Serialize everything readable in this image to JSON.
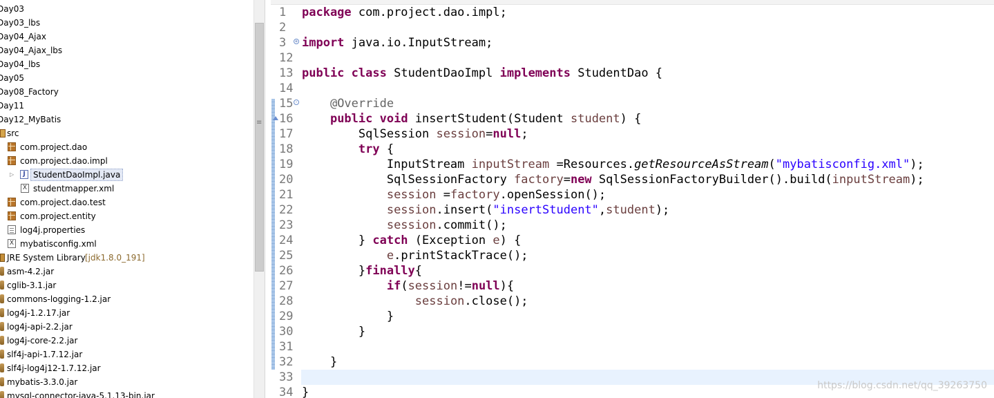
{
  "explorer": {
    "rows": [
      {
        "label": "Day03",
        "icon": "project-icon"
      },
      {
        "label": "Day03_lbs",
        "icon": "project-icon"
      },
      {
        "label": "Day04_Ajax",
        "icon": "project-icon"
      },
      {
        "label": "Day04_Ajax_lbs",
        "icon": "project-icon"
      },
      {
        "label": "Day04_lbs",
        "icon": "project-icon"
      },
      {
        "label": "Day05",
        "icon": "project-icon"
      },
      {
        "label": "Day08_Factory",
        "icon": "project-icon"
      },
      {
        "label": "Day11",
        "icon": "project-icon"
      },
      {
        "label": "Day12_MyBatis",
        "icon": "project-icon"
      },
      {
        "label": "src",
        "icon": "source-folder-icon"
      },
      {
        "label": "com.project.dao",
        "icon": "package-icon"
      },
      {
        "label": "com.project.dao.impl",
        "icon": "package-icon"
      },
      {
        "label": "StudentDaoImpl.java",
        "icon": "java-file-icon",
        "selected": true
      },
      {
        "label": "studentmapper.xml",
        "icon": "xml-file-icon"
      },
      {
        "label": "com.project.dao.test",
        "icon": "package-icon"
      },
      {
        "label": "com.project.entity",
        "icon": "package-icon"
      },
      {
        "label": "log4j.properties",
        "icon": "properties-file-icon"
      },
      {
        "label": "mybatisconfig.xml",
        "icon": "xml-file-icon"
      },
      {
        "label": "JRE System Library",
        "suffix": "[jdk1.8.0_191]",
        "icon": "library-icon"
      },
      {
        "label": "asm-4.2.jar",
        "icon": "jar-icon"
      },
      {
        "label": "cglib-3.1.jar",
        "icon": "jar-icon"
      },
      {
        "label": "commons-logging-1.2.jar",
        "icon": "jar-icon"
      },
      {
        "label": "log4j-1.2.17.jar",
        "icon": "jar-icon"
      },
      {
        "label": "log4j-api-2.2.jar",
        "icon": "jar-icon"
      },
      {
        "label": "log4j-core-2.2.jar",
        "icon": "jar-icon"
      },
      {
        "label": "slf4j-api-1.7.12.jar",
        "icon": "jar-icon"
      },
      {
        "label": "slf4j-log4j12-1.7.12.jar",
        "icon": "jar-icon"
      },
      {
        "label": "mybatis-3.3.0.jar",
        "icon": "jar-icon"
      },
      {
        "label": "mysql-connector-java-5.1.13-bin.jar",
        "icon": "jar-icon"
      }
    ]
  },
  "editor": {
    "lines": [
      {
        "num": "1",
        "tokens": [
          {
            "t": "package",
            "c": "kw"
          },
          {
            "t": " com.project.dao.impl;"
          }
        ]
      },
      {
        "num": "2",
        "tokens": []
      },
      {
        "num": "3",
        "fold": "+",
        "tokens": [
          {
            "t": "import",
            "c": "kw"
          },
          {
            "t": " java.io.InputStream;"
          }
        ]
      },
      {
        "num": "12",
        "tokens": []
      },
      {
        "num": "13",
        "tokens": [
          {
            "t": "public",
            "c": "kw"
          },
          {
            "t": " "
          },
          {
            "t": "class",
            "c": "kw"
          },
          {
            "t": " StudentDaoImpl "
          },
          {
            "t": "implements",
            "c": "kw"
          },
          {
            "t": " StudentDao {"
          }
        ]
      },
      {
        "num": "14",
        "tokens": []
      },
      {
        "num": "15",
        "fold": "-",
        "tokens": [
          {
            "t": "    "
          },
          {
            "t": "@Override",
            "c": "ann"
          }
        ]
      },
      {
        "num": "16",
        "marker": "override-marker",
        "tokens": [
          {
            "t": "    "
          },
          {
            "t": "public",
            "c": "kw"
          },
          {
            "t": " "
          },
          {
            "t": "void",
            "c": "kw"
          },
          {
            "t": " insertStudent(Student "
          },
          {
            "t": "student",
            "c": "fld"
          },
          {
            "t": ") {"
          }
        ]
      },
      {
        "num": "17",
        "tokens": [
          {
            "t": "        SqlSession "
          },
          {
            "t": "session",
            "c": "fld"
          },
          {
            "t": "="
          },
          {
            "t": "null",
            "c": "kw"
          },
          {
            "t": ";"
          }
        ]
      },
      {
        "num": "18",
        "tokens": [
          {
            "t": "        "
          },
          {
            "t": "try",
            "c": "kw"
          },
          {
            "t": " {"
          }
        ]
      },
      {
        "num": "19",
        "tokens": [
          {
            "t": "            InputStream "
          },
          {
            "t": "inputStream",
            "c": "fld"
          },
          {
            "t": " =Resources."
          },
          {
            "t": "getResourceAsStream",
            "c": "ital"
          },
          {
            "t": "("
          },
          {
            "t": "\"mybatisconfig.xml\"",
            "c": "str"
          },
          {
            "t": ");"
          }
        ]
      },
      {
        "num": "20",
        "tokens": [
          {
            "t": "            SqlSessionFactory "
          },
          {
            "t": "factory",
            "c": "fld"
          },
          {
            "t": "="
          },
          {
            "t": "new",
            "c": "kw"
          },
          {
            "t": " SqlSessionFactoryBuilder().build("
          },
          {
            "t": "inputStream",
            "c": "fld"
          },
          {
            "t": ");"
          }
        ]
      },
      {
        "num": "21",
        "tokens": [
          {
            "t": "            "
          },
          {
            "t": "session",
            "c": "fld"
          },
          {
            "t": " ="
          },
          {
            "t": "factory",
            "c": "fld"
          },
          {
            "t": ".openSession();"
          }
        ]
      },
      {
        "num": "22",
        "tokens": [
          {
            "t": "            "
          },
          {
            "t": "session",
            "c": "fld"
          },
          {
            "t": ".insert("
          },
          {
            "t": "\"insertStudent\"",
            "c": "str"
          },
          {
            "t": ","
          },
          {
            "t": "student",
            "c": "fld"
          },
          {
            "t": ");"
          }
        ]
      },
      {
        "num": "23",
        "tokens": [
          {
            "t": "            "
          },
          {
            "t": "session",
            "c": "fld"
          },
          {
            "t": ".commit();"
          }
        ]
      },
      {
        "num": "24",
        "tokens": [
          {
            "t": "        } "
          },
          {
            "t": "catch",
            "c": "kw"
          },
          {
            "t": " (Exception "
          },
          {
            "t": "e",
            "c": "fld"
          },
          {
            "t": ") {"
          }
        ]
      },
      {
        "num": "25",
        "tokens": [
          {
            "t": "            "
          },
          {
            "t": "e",
            "c": "fld"
          },
          {
            "t": ".printStackTrace();"
          }
        ]
      },
      {
        "num": "26",
        "tokens": [
          {
            "t": "        }"
          },
          {
            "t": "finally",
            "c": "kw"
          },
          {
            "t": "{"
          }
        ]
      },
      {
        "num": "27",
        "tokens": [
          {
            "t": "            "
          },
          {
            "t": "if",
            "c": "kw"
          },
          {
            "t": "("
          },
          {
            "t": "session",
            "c": "fld"
          },
          {
            "t": "!="
          },
          {
            "t": "null",
            "c": "kw"
          },
          {
            "t": "){"
          }
        ]
      },
      {
        "num": "28",
        "tokens": [
          {
            "t": "                "
          },
          {
            "t": "session",
            "c": "fld"
          },
          {
            "t": ".close();"
          }
        ]
      },
      {
        "num": "29",
        "tokens": [
          {
            "t": "            }"
          }
        ]
      },
      {
        "num": "30",
        "tokens": [
          {
            "t": "        }"
          }
        ]
      },
      {
        "num": "31",
        "tokens": []
      },
      {
        "num": "32",
        "tokens": [
          {
            "t": "    }"
          }
        ]
      },
      {
        "num": "33",
        "tokens": []
      },
      {
        "num": "34",
        "tokens": [
          {
            "t": "}"
          }
        ]
      }
    ]
  },
  "watermark": "https://blog.csdn.net/qq_39263750"
}
